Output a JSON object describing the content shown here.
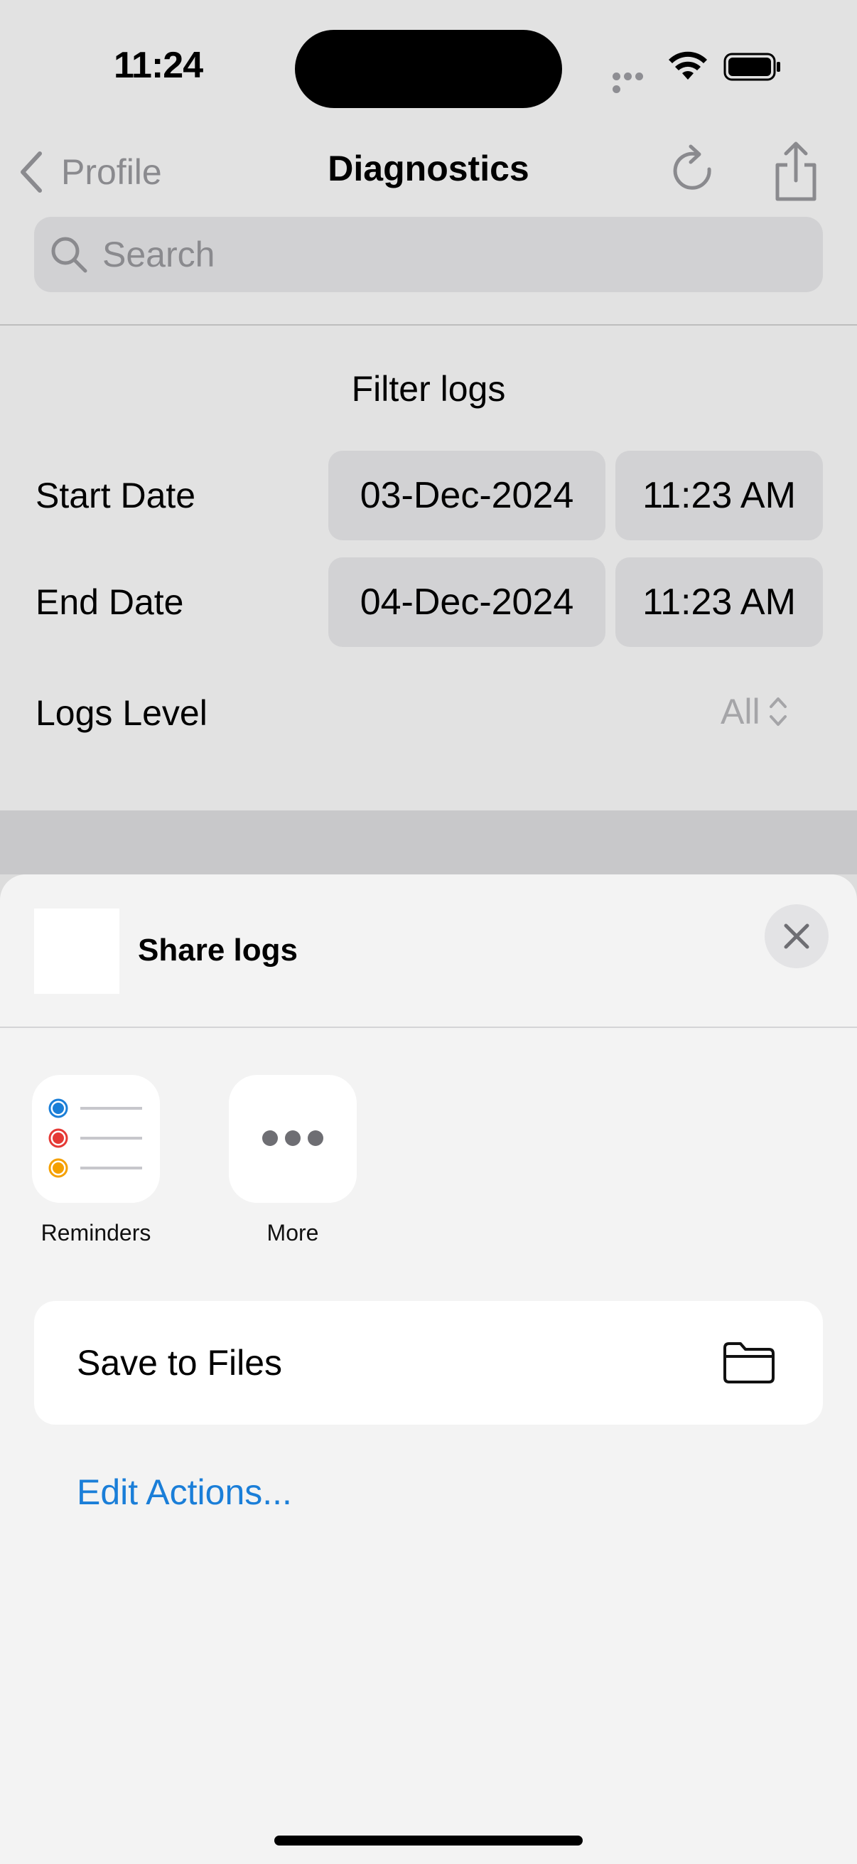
{
  "status_bar": {
    "time": "11:24"
  },
  "nav": {
    "back_label": "Profile",
    "title": "Diagnostics"
  },
  "search": {
    "placeholder": "Search"
  },
  "filter": {
    "title": "Filter logs",
    "start": {
      "label": "Start Date",
      "date": "03-Dec-2024",
      "time": "11:23 AM"
    },
    "end": {
      "label": "End Date",
      "date": "04-Dec-2024",
      "time": "11:23 AM"
    },
    "logs_level": {
      "label": "Logs Level",
      "value": "All"
    }
  },
  "share_sheet": {
    "title": "Share logs",
    "apps": [
      {
        "label": "Reminders",
        "icon": "reminders-icon"
      },
      {
        "label": "More",
        "icon": "more-icon"
      }
    ],
    "actions": [
      {
        "label": "Save to Files",
        "icon": "folder-icon"
      }
    ],
    "edit_label": "Edit Actions..."
  },
  "colors": {
    "accent": "#1a7ed8",
    "sheet_bg": "#f3f3f3",
    "dimmed_bg": "#e2e2e2"
  }
}
